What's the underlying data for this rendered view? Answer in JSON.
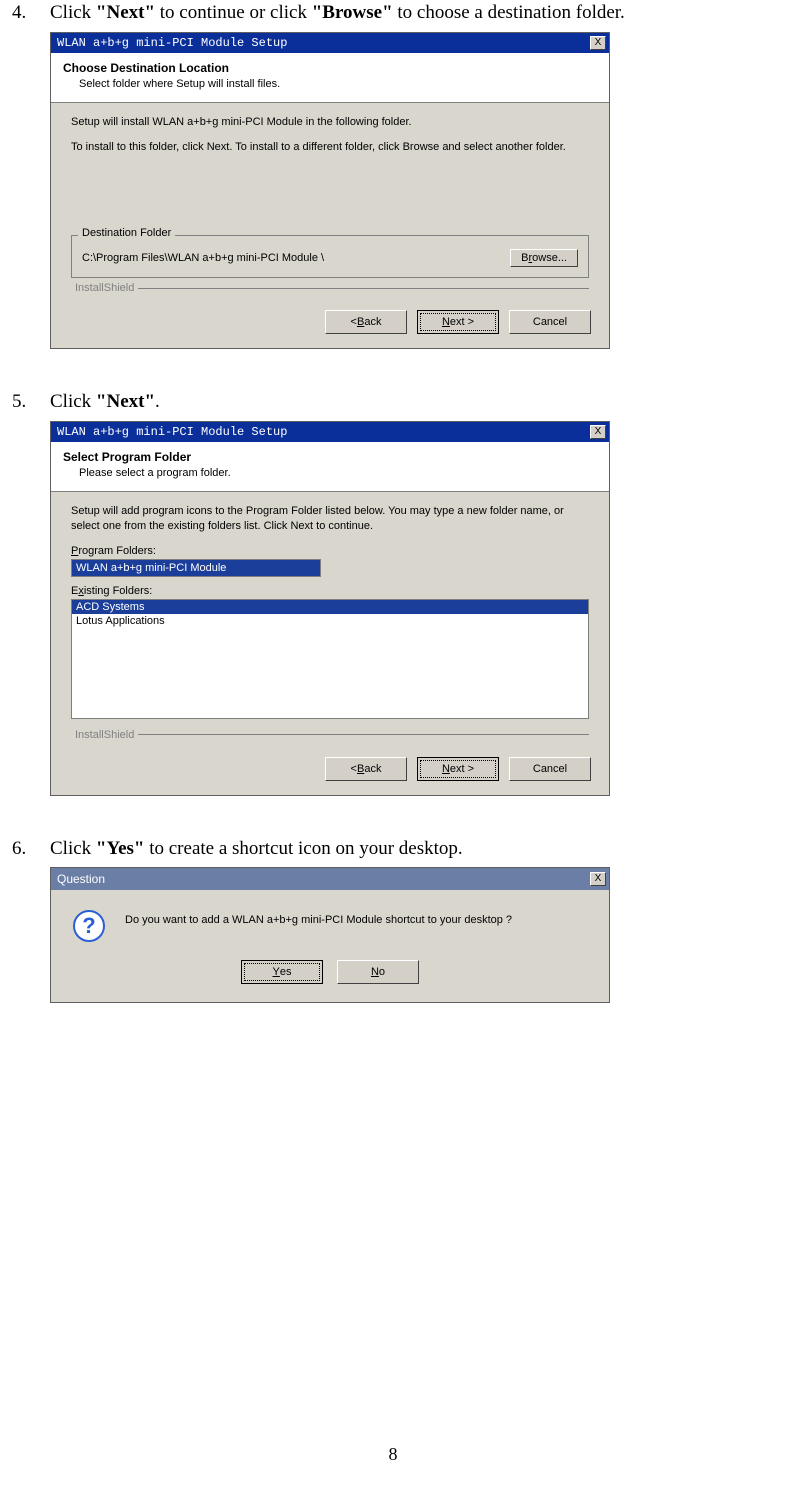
{
  "step4": {
    "num": "4.",
    "pre": "Click ",
    "b1": "\"Next\"",
    "mid": " to continue or click ",
    "b2": "\"Browse\"",
    "post": " to choose a destination folder."
  },
  "step5": {
    "num": "5.",
    "pre": "Click ",
    "b1": "\"Next\"",
    "post": "."
  },
  "step6": {
    "num": "6.",
    "pre": "Click ",
    "b1": "\"Yes\"",
    "post": " to create a shortcut icon on your desktop."
  },
  "dlg1": {
    "title": "WLAN a+b+g mini-PCI Module Setup",
    "heading": "Choose Destination Location",
    "sub": "Select folder where Setup will install files.",
    "p1a": "Setup will install WLAN a+b+g ",
    "p1b": "mini-PCI Module",
    "p1c": " in the following folder.",
    "p2": "To install to this folder, click Next. To install to a different folder, click Browse and select another folder.",
    "group_legend": "Destination Folder",
    "patha": "C:\\Program Files\\WLAN a+b+g ",
    "pathb": "mini-PCI Module",
    "pathc": " \\",
    "browse_u": "r",
    "browse_pre": "B",
    "browse_post": "owse...",
    "installshield": "InstallShield",
    "back_pre": "< ",
    "back_u": "B",
    "back_post": "ack",
    "next_u": "N",
    "next_post": "ext >",
    "cancel": "Cancel"
  },
  "dlg2": {
    "title": "WLAN a+b+g mini-PCI Module Setup",
    "heading": "Select Program Folder",
    "sub": "Please select a program folder.",
    "p1": "Setup will add program icons to the Program Folder listed below.  You may type a new folder name, or select one from the existing folders list.  Click Next to continue.",
    "label_pf_u": "P",
    "label_pf_post": "rogram Folders:",
    "pf_value_a": "WLAN a+b+g ",
    "pf_value_b": "mini-PCI Module",
    "label_ex_pre": "E",
    "label_ex_u": "x",
    "label_ex_post": "isting Folders:",
    "ex1": "ACD Systems",
    "ex2": "Lotus Applications",
    "installshield": "InstallShield",
    "back_pre": "< ",
    "back_u": "B",
    "back_post": "ack",
    "next_u": "N",
    "next_post": "ext >",
    "cancel": "Cancel"
  },
  "dlg3": {
    "title": "Question",
    "msg_a": "Do you want to add a WLAN a+b+g ",
    "msg_b": "mini-PCI Module",
    "msg_c": " shortcut to your desktop ?",
    "yes_u": "Y",
    "yes_post": "es",
    "no_u": "N",
    "no_post": "o"
  },
  "page_number": "8",
  "close_x": "X"
}
